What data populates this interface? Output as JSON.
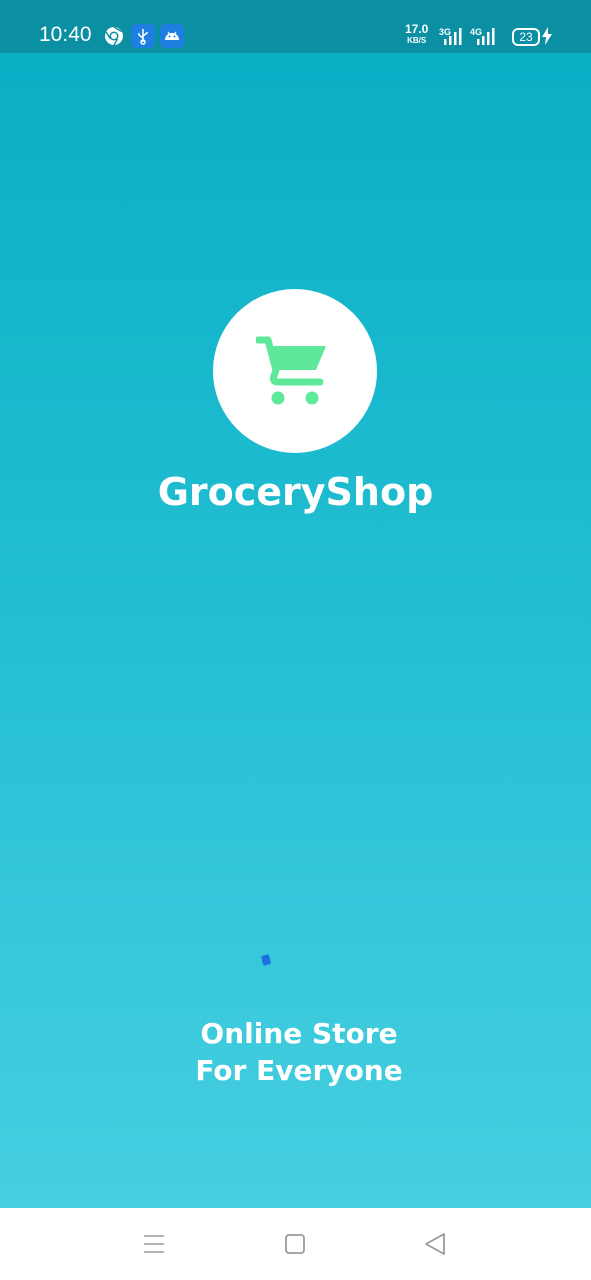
{
  "status_bar": {
    "time": "10:40",
    "net_speed_value": "17.0",
    "net_speed_unit": "KB/S",
    "network_1": "3G",
    "network_2": "4G",
    "battery": "23",
    "icons": [
      "chrome-icon",
      "usb-icon",
      "android-icon",
      "signal-icon",
      "battery-icon",
      "charging-icon"
    ]
  },
  "splash": {
    "logo_icon": "shopping-cart-icon",
    "app_name": "GroceryShop",
    "tagline_line1": "Online Store",
    "tagline_line2": "For Everyone"
  },
  "nav_bar": {
    "buttons": [
      "menu-icon",
      "home-icon",
      "back-icon"
    ]
  },
  "colors": {
    "status_bar": "#0a8fa3",
    "gradient_top": "#07aec5",
    "gradient_bottom": "#4bd1e3",
    "cart_green": "#5ee89a",
    "spinner_blue": "#1f6fe0"
  }
}
